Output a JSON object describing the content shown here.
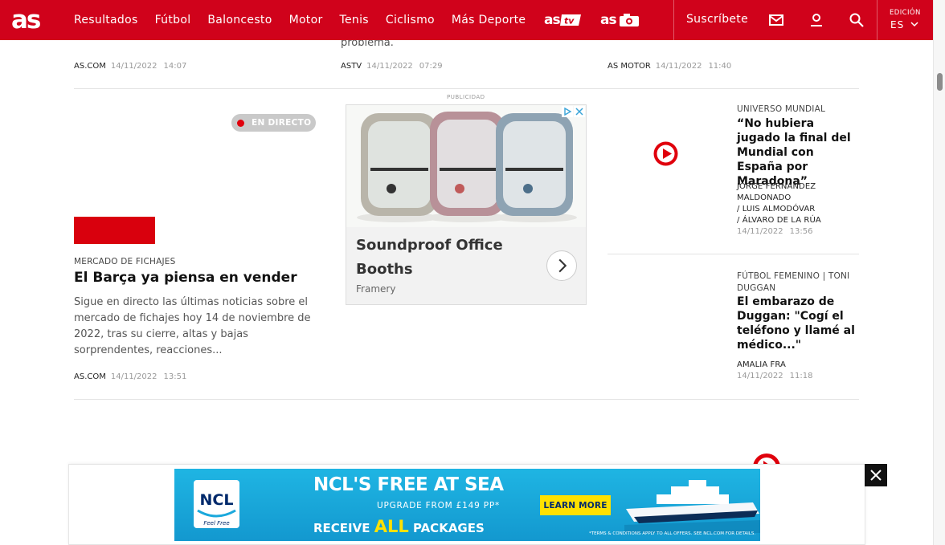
{
  "header": {
    "logo_text": "as",
    "nav": [
      "Resultados",
      "Fútbol",
      "Baloncesto",
      "Motor",
      "Tenis",
      "Ciclismo",
      "Más Deporte"
    ],
    "brand_tv_text": "as tv",
    "brand_foto_text": "as",
    "subscribe_label": "Suscríbete",
    "edition_label": "EDICIÓN",
    "edition_value": "ES",
    "icons": [
      "mail-icon",
      "user-icon",
      "search-icon",
      "chevron-down-icon"
    ],
    "colors": {
      "brand_red": "#d0021b",
      "text_on_brand": "#ffffff"
    }
  },
  "top_row": {
    "residue_text": "problema.",
    "items": [
      {
        "source": "AS.COM",
        "date": "14/11/2022",
        "time": "14:07"
      },
      {
        "source": "ASTV",
        "date": "14/11/2022",
        "time": "07:29"
      },
      {
        "source": "AS MOTOR",
        "date": "14/11/2022",
        "time": "11:40"
      }
    ]
  },
  "live_story": {
    "badge": "EN DIRECTO",
    "kicker": "MERCADO DE FICHAJES",
    "headline": "El Barça ya piensa en vender",
    "excerpt": "Sigue en directo las últimas noticias sobre el mercado de fichajes hoy 14 de noviembre de 2022, tras su cierre, altas y bajas sorprendentes, reacciones...",
    "source": "AS.COM",
    "date": "14/11/2022",
    "time": "13:51"
  },
  "ad_box": {
    "label": "PUBLICIDAD",
    "title": "Soundproof Office Booths",
    "brand": "Framery"
  },
  "side_stories": [
    {
      "kicker": "UNIVERSO MUNDIAL",
      "headline": "“No hubiera jugado la final del Mundial con España por Maradona”",
      "authors": [
        "JORGE FERNÁNDEZ MALDONADO",
        "/  LUIS ALMODÓVAR",
        "/  ÁLVARO DE LA RÚA"
      ],
      "date": "14/11/2022",
      "time": "13:56"
    },
    {
      "kicker": "FÚTBOL FEMENINO | TONI DUGGAN",
      "headline": "El embarazo de Duggan: \"Cogí el teléfono y llamé al médico...\"",
      "authors": [
        "AMALIA FRA"
      ],
      "date": "14/11/2022",
      "time": "11:18"
    }
  ],
  "sticky_ad": {
    "logo": "NCL",
    "logo_sub": "Feel Free",
    "line1": "NCL'S FREE AT SEA",
    "line2": "UPGRADE FROM £149 PP*",
    "line3_a": "RECEIVE ",
    "line3_b": "ALL",
    "line3_c": " PACKAGES",
    "cta": "LEARN MORE",
    "fine_print": "*TERMS & CONDITIONS APPLY TO ALL OFFERS. SEE NCL.COM FOR DETAILS.",
    "colors": {
      "sea": "#1aa8dc",
      "yellow": "#ffe100"
    }
  }
}
